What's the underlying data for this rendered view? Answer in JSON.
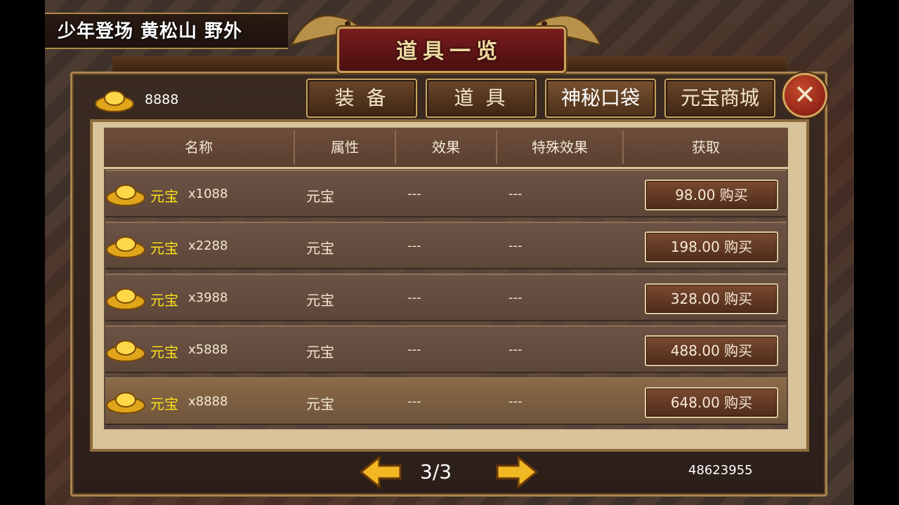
{
  "location": "少年登场 黄松山 野外",
  "title": "道具一览",
  "currency": {
    "icon": "gold-ingot-icon",
    "amount": "8888"
  },
  "tabs": [
    {
      "label": "装 备",
      "active": false
    },
    {
      "label": "道 具",
      "active": false
    },
    {
      "label": "神秘口袋",
      "active": true
    },
    {
      "label": "元宝商城",
      "active": false
    }
  ],
  "table": {
    "headers": [
      "名称",
      "属性",
      "效果",
      "特殊效果",
      "获取"
    ],
    "rows": [
      {
        "name": "元宝",
        "qty": "x1088",
        "attr": "元宝",
        "effect": "---",
        "special": "---",
        "price": "98.00 购买"
      },
      {
        "name": "元宝",
        "qty": "x2288",
        "attr": "元宝",
        "effect": "---",
        "special": "---",
        "price": "198.00 购买"
      },
      {
        "name": "元宝",
        "qty": "x3988",
        "attr": "元宝",
        "effect": "---",
        "special": "---",
        "price": "328.00 购买"
      },
      {
        "name": "元宝",
        "qty": "x5888",
        "attr": "元宝",
        "effect": "---",
        "special": "---",
        "price": "488.00 购买"
      },
      {
        "name": "元宝",
        "qty": "x8888",
        "attr": "元宝",
        "effect": "---",
        "special": "---",
        "price": "648.00 购买"
      }
    ]
  },
  "pagination": {
    "label": "3/3"
  },
  "player_id": "48623955",
  "colors": {
    "item_name": "#ffe21a",
    "frame": "#c9a25a"
  }
}
